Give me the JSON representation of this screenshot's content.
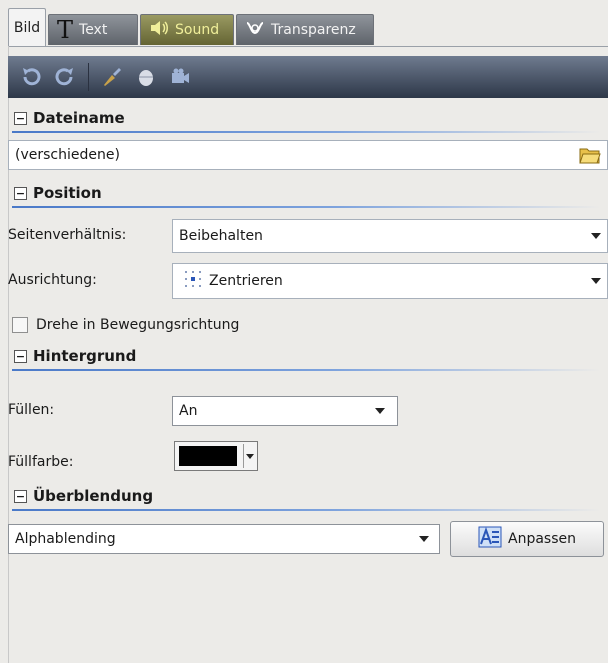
{
  "tabs": [
    {
      "label": "Bild",
      "active": true
    },
    {
      "label": "Text",
      "active": false
    },
    {
      "label": "Sound",
      "active": false
    },
    {
      "label": "Transparenz",
      "active": false
    }
  ],
  "toolbar": {
    "icons": [
      "undo-icon",
      "redo-icon",
      "brush-icon",
      "mouse-icon",
      "camera-icon"
    ]
  },
  "dateiname": {
    "title": "Dateiname",
    "value": "(verschiedene)"
  },
  "position": {
    "title": "Position",
    "aspect_label": "Seitenverhältnis:",
    "aspect_value": "Beibehalten",
    "align_label": "Ausrichtung:",
    "align_value": "Zentrieren",
    "rotate_label": "Drehe in Bewegungsrichtung",
    "rotate_checked": false
  },
  "hintergrund": {
    "title": "Hintergrund",
    "fill_label": "Füllen:",
    "fill_value": "An",
    "color_label": "Füllfarbe:",
    "color_value": "#000000"
  },
  "ueberblendung": {
    "title": "Überblendung",
    "mode_value": "Alphablending",
    "adjust_label": "Anpassen"
  },
  "colors": {
    "accent_line": "#4a79c8",
    "toolbar_bg": "#3a4458",
    "panel_bg": "#ecebe8"
  }
}
